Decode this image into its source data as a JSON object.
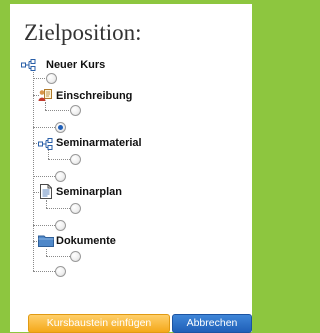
{
  "dialog": {
    "title": "Zielposition:"
  },
  "tree": {
    "root_label": "Neuer Kurs",
    "nodes": [
      {
        "label": "Einschreibung",
        "icon": "enrollment-icon"
      },
      {
        "label": "Seminarmaterial",
        "icon": "structure-icon"
      },
      {
        "label": "Seminarplan",
        "icon": "document-icon"
      },
      {
        "label": "Dokumente",
        "icon": "folder-icon"
      }
    ],
    "selected_position": "before Seminarmaterial"
  },
  "buttons": {
    "insert_label": "Kursbaustein einfügen",
    "cancel_label": "Abbrechen"
  },
  "colors": {
    "background": "#8dc63f",
    "insert_button": "#f4a81a",
    "cancel_button": "#1f5fb8"
  }
}
